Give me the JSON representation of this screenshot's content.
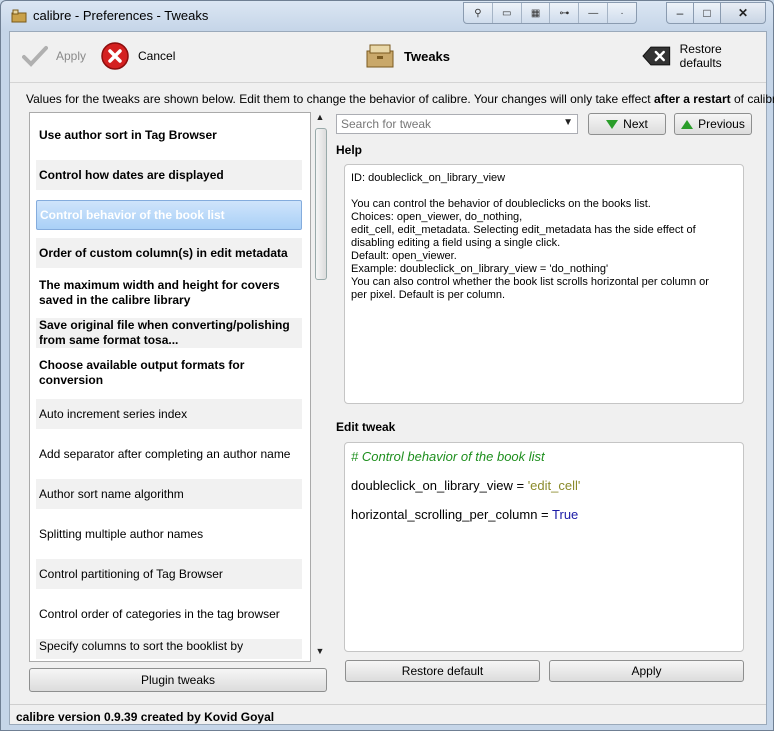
{
  "window": {
    "title": "calibre - Preferences - Tweaks",
    "controls": {
      "minimize": "–",
      "maximize": "□",
      "close": "✕"
    }
  },
  "toolbar": {
    "apply_label": "Apply",
    "cancel_label": "Cancel",
    "section_label": "Tweaks",
    "restore_defaults_label": "Restore defaults"
  },
  "description": {
    "before": "Values for the tweaks are shown below. Edit them to change the behavior of calibre. Your changes will only take effect ",
    "bold": "after a restart",
    "after": " of calibre."
  },
  "tweak_list": {
    "items": [
      {
        "label": "Use author sort in Tag Browser",
        "bold": true
      },
      {
        "label": "Control how dates are displayed",
        "bold": true
      },
      {
        "label": "Control behavior of the book list",
        "bold": true,
        "selected": true
      },
      {
        "label": "Order of custom column(s) in edit metadata",
        "bold": true
      },
      {
        "label": "The maximum width and height for covers saved in the calibre library",
        "bold": true
      },
      {
        "label": "Save original file when converting/polishing from same format tosa...",
        "bold": true
      },
      {
        "label": "Choose available output formats for conversion",
        "bold": true
      },
      {
        "label": "Auto increment series index",
        "bold": false
      },
      {
        "label": "Add separator after completing an author name",
        "bold": false
      },
      {
        "label": "Author sort name algorithm",
        "bold": false
      },
      {
        "label": "Splitting multiple author names",
        "bold": false
      },
      {
        "label": "Control partitioning of Tag Browser",
        "bold": false
      },
      {
        "label": "Control order of categories in the tag browser",
        "bold": false
      },
      {
        "label": "Specify columns to sort the booklist by",
        "bold": false
      }
    ]
  },
  "plugin_tweaks_label": "Plugin tweaks",
  "search": {
    "placeholder": "Search for tweak"
  },
  "nav": {
    "next_label": "Next",
    "previous_label": "Previous"
  },
  "help": {
    "heading": "Help",
    "text": "ID: doubleclick_on_library_view\n\nYou can control the behavior of doubleclicks on the books list.\nChoices: open_viewer, do_nothing,\nedit_cell, edit_metadata. Selecting edit_metadata has the side effect of\ndisabling editing a field using a single click.\nDefault: open_viewer.\nExample: doubleclick_on_library_view = 'do_nothing'\nYou can also control whether the book list scrolls horizontal per column or\nper pixel. Default is per column."
  },
  "edit": {
    "heading": "Edit tweak",
    "comment": "# Control behavior of the book list",
    "line1_name": "doubleclick_on_library_view",
    "line1_op": " = ",
    "line1_value": "'edit_cell'",
    "line2_name": "horizontal_scrolling_per_column",
    "line2_op": " = ",
    "line2_value": "True"
  },
  "buttons": {
    "restore_default_label": "Restore default",
    "apply_label": "Apply"
  },
  "status": "calibre version 0.9.39 created by Kovid Goyal",
  "colors": {
    "selection": "#a9d0f7",
    "comment": "#1e8f1e",
    "string": "#8a8a2a",
    "keyword": "#1a1aa6",
    "arrow": "#2a9d2a"
  }
}
